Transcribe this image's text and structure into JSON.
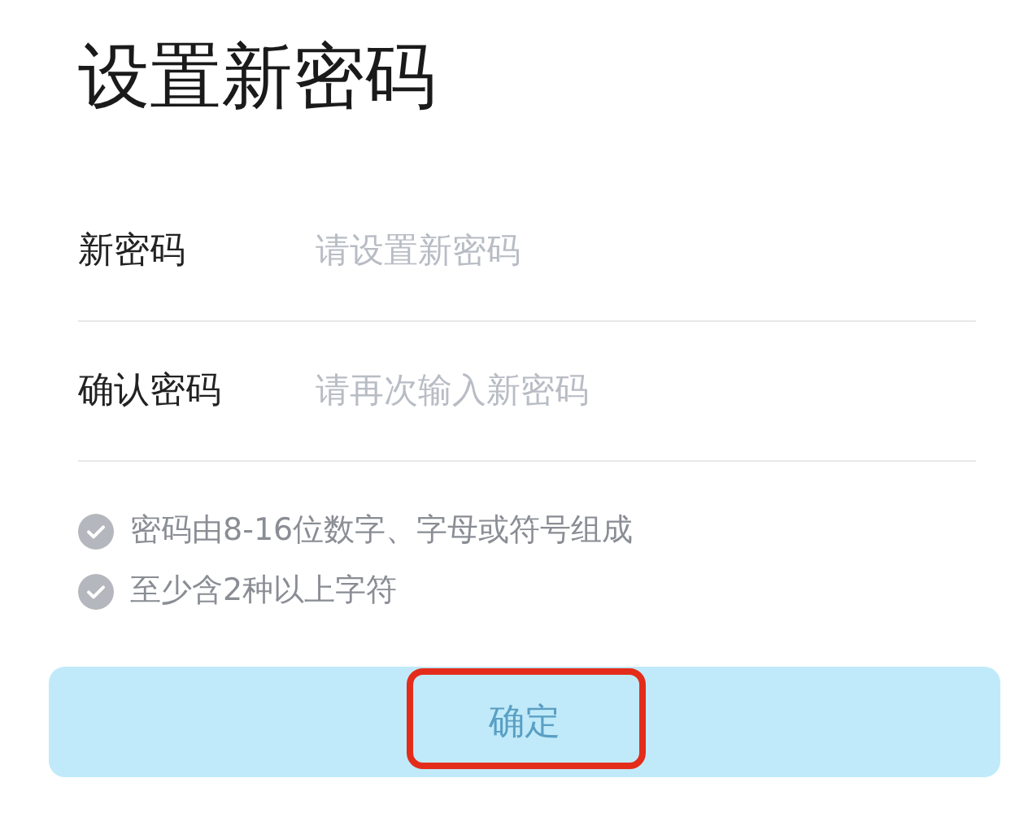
{
  "title": "设置新密码",
  "fields": [
    {
      "label": "新密码",
      "placeholder": "请设置新密码"
    },
    {
      "label": "确认密码",
      "placeholder": "请再次输入新密码"
    }
  ],
  "rules": [
    {
      "text": "密码由8-16位数字、字母或符号组成",
      "checked": false
    },
    {
      "text": "至少含2种以上字符",
      "checked": false
    }
  ],
  "submit": {
    "label": "确定",
    "disabled": true,
    "highlighted": true
  }
}
